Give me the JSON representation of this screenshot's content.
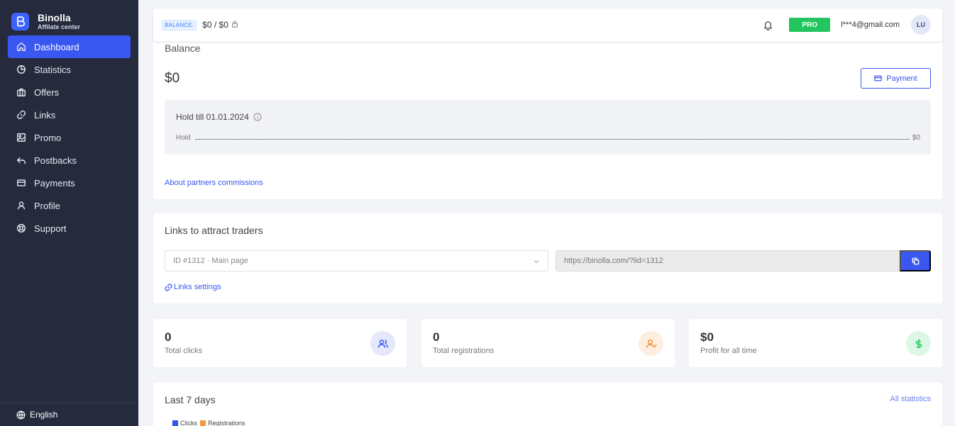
{
  "brand": {
    "name": "Binolla",
    "subtitle": "Affilate center",
    "accent": "#3d63ff"
  },
  "sidebar": {
    "items": [
      {
        "label": "Dashboard",
        "icon": "home-icon",
        "active": true
      },
      {
        "label": "Statistics",
        "icon": "pie-chart-icon"
      },
      {
        "label": "Offers",
        "icon": "briefcase-icon"
      },
      {
        "label": "Links",
        "icon": "link-icon"
      },
      {
        "label": "Promo",
        "icon": "image-icon"
      },
      {
        "label": "Postbacks",
        "icon": "reply-arrow-icon"
      },
      {
        "label": "Payments",
        "icon": "credit-card-icon"
      },
      {
        "label": "Profile",
        "icon": "user-icon"
      },
      {
        "label": "Support",
        "icon": "lifebuoy-icon"
      }
    ],
    "language": "English"
  },
  "topbar": {
    "balance_tag": "BALANCE:",
    "balance_value": "$0 / $0",
    "pro_label": "PRO",
    "email": "l***4@gmail.com",
    "avatar_initials": "LU"
  },
  "balance": {
    "title": "Balance",
    "amount": "$0",
    "payment_button": "Payment",
    "hold_title": "Hold till 01.01.2024",
    "hold_label": "Hold",
    "hold_value": "$0",
    "about_link": "About partners commissions"
  },
  "links": {
    "title": "Links to attract traders",
    "select_value": "ID #1312 · Main page",
    "url": "https://binolla.com/?lid=1312",
    "settings_link": "Links settings"
  },
  "stats": [
    {
      "value": "0",
      "label": "Total clicks",
      "icon": "users-icon"
    },
    {
      "value": "0",
      "label": "Total registrations",
      "icon": "user-check-icon"
    },
    {
      "value": "$0",
      "label": "Profit for all time",
      "icon": "dollar-icon"
    }
  ],
  "week": {
    "title": "Last 7 days",
    "all_stats_link": "All statistics",
    "legend": [
      {
        "name": "Clicks",
        "color": "#2f54eb"
      },
      {
        "name": "Registrations",
        "color": "#f59a3b"
      }
    ]
  }
}
